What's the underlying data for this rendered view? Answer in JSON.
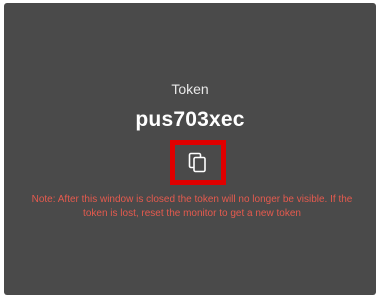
{
  "dialog": {
    "token_label": "Token",
    "token_value": "pus703xec",
    "copy_icon": "copy-icon",
    "note": "Note: After this window is closed the token will no longer be visible. If the token is lost, reset the monitor to get a new token"
  },
  "colors": {
    "background": "#4a4a4a",
    "highlight": "#e00000",
    "note_text": "#e55a4e"
  }
}
